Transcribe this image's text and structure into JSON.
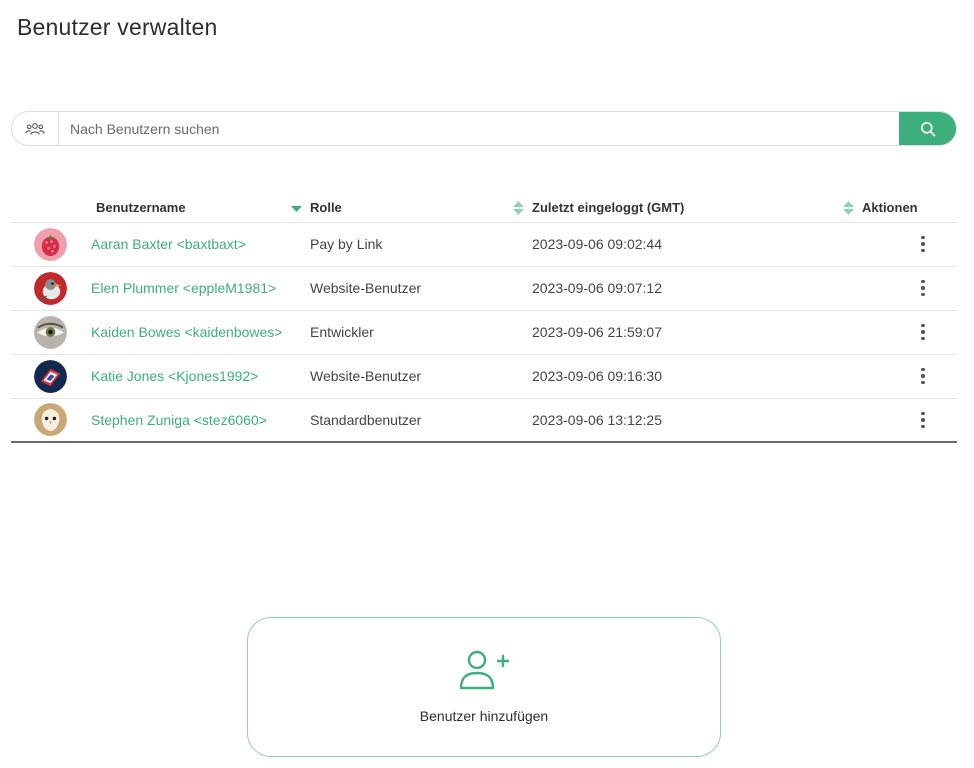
{
  "page": {
    "title": "Benutzer verwalten"
  },
  "search": {
    "placeholder": "Nach Benutzern suchen",
    "value": ""
  },
  "table": {
    "columns": [
      {
        "label": "Benutzername",
        "sort": "descending"
      },
      {
        "label": "Rolle",
        "sort": "none"
      },
      {
        "label": "Zuletzt eingeloggt (GMT)",
        "sort": "none"
      },
      {
        "label": "Aktionen"
      }
    ],
    "rows": [
      {
        "name": "Aaran Baxter <baxtbaxt>",
        "role": "Pay by Link",
        "last_login": "2023-09-06 09:02:44",
        "avatar": "raspberry-avatar"
      },
      {
        "name": "Elen Plummer <eppleM1981>",
        "role": "Website-Benutzer",
        "last_login": "2023-09-06 09:07:12",
        "avatar": "bird-avatar"
      },
      {
        "name": "Kaiden Bowes <kaidenbowes>",
        "role": "Entwickler",
        "last_login": "2023-09-06 21:59:07",
        "avatar": "eye-avatar"
      },
      {
        "name": "Katie Jones <Kjones1992>",
        "role": "Website-Benutzer",
        "last_login": "2023-09-06 09:16:30",
        "avatar": "flag-avatar"
      },
      {
        "name": "Stephen Zuniga <stez6060>",
        "role": "Standardbenutzer",
        "last_login": "2023-09-06 13:12:25",
        "avatar": "owl-avatar"
      }
    ]
  },
  "add_user": {
    "label": "Benutzer hinzufügen",
    "icon": "add-user-icon"
  },
  "colors": {
    "accent": "#3daf7d",
    "accent_light": "#8ed1b3",
    "text": "#333333"
  }
}
